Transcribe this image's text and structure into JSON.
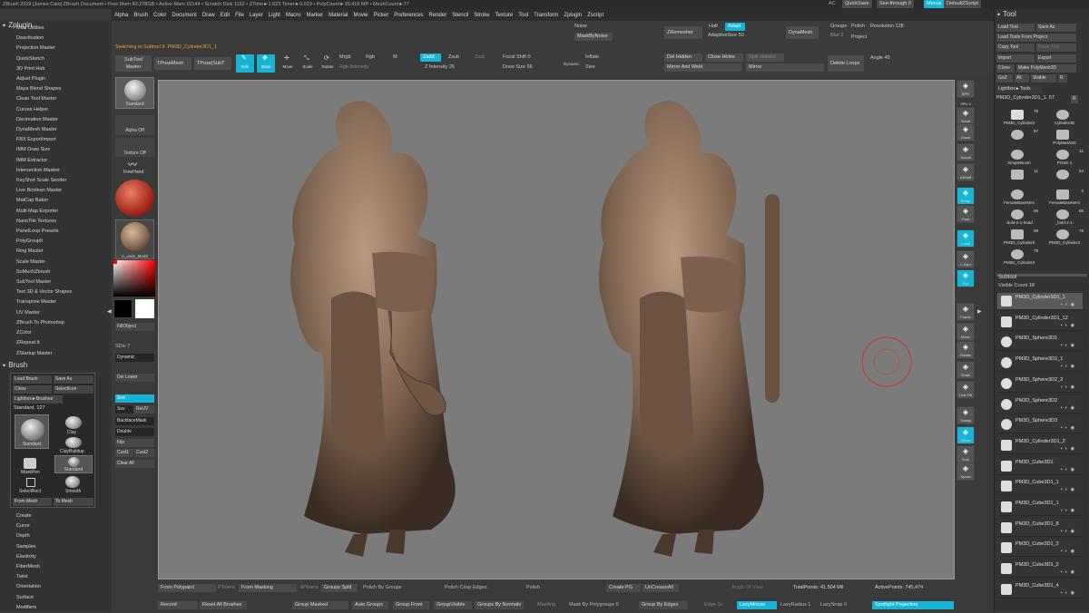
{
  "title": "ZBrush 2019 [James Cain]   ZBrush Document    • Free Mem 42.278GB • Active Mem 15144 • Scratch Disk 1162 • ZTime►1.623 Timer►0.019 • PolyCount►39.415 MP • MeshCount►77",
  "titlebar_right": {
    "ac": "AC",
    "quicksave": "QuickSave",
    "seethrough": "See-through  0",
    "menus": "Menus",
    "script": "DefaultZScript"
  },
  "menu": [
    "Alpha",
    "Brush",
    "Color",
    "Document",
    "Draw",
    "Edit",
    "File",
    "Layer",
    "Light",
    "Macro",
    "Marker",
    "Material",
    "Movie",
    "Picker",
    "Preferences",
    "Render",
    "Stencil",
    "Stroke",
    "Texture",
    "Tool",
    "Transform",
    "Zplugin",
    "Zscript"
  ],
  "left": {
    "zplugin_title": "Zplugin",
    "plugins": [
      "Misc Utilities",
      "Deactivation",
      "Projection Master",
      "QuickSketch",
      "3D Print Hub",
      "Adjust Plugin",
      "Maya Blend Shapes",
      "Clean Tool Master",
      "Curves Helper",
      "Decimation Master",
      "DynaMesh Master",
      "FBX ExportImport",
      "IMM Draw Size",
      "IMM Extractor",
      "Intersection Masker",
      "KeyShot Scale Sender",
      "Live Boolean Master",
      "MatCap Baker",
      "Multi Map Exporter",
      "NanoTile Textures",
      "PanelLoop Presets",
      "PolyGroupIt",
      "Ring Master",
      "Scale Master",
      "SoMuchZbrush",
      "SubTool Master",
      "Text 3D & Vector Shapes",
      "Transpose Master",
      "UV Master",
      "ZBrush To Photoshop",
      "ZColor",
      "ZRepeat It",
      "ZStartup Master"
    ],
    "brush_title": "Brush",
    "brush": {
      "load": "Load Brush",
      "save": "Save As",
      "clone": "Clone",
      "selicon": "SelectIcon",
      "lightbox": "Lightbox►Brushes",
      "standard": "Standard. 127",
      "b_standard": "Standard",
      "clay": "Clay",
      "claybuildup": "ClayBuildup",
      "maskpen": "MaskPen",
      "standard2": "Standard",
      "selectrect": "SelectRect",
      "smooth": "Smooth",
      "frommesh": "From Mesh",
      "tomesh": "To Mesh"
    },
    "curve_items": [
      "Create",
      "Curve",
      "Depth",
      "Samples",
      "Elasticity",
      "FiberMesh",
      "Twist",
      "Orientation",
      "Surface",
      "Modifiers"
    ]
  },
  "shelf": {
    "standard": "Standard",
    "alphaoff": "Alpha Off",
    "textureoff": "Texture Off",
    "freehand": "FreeHand",
    "matname": "o_undo_Mud3",
    "fillobject": "FillObject",
    "sdiv": "SDiv 7",
    "dynamic": "Dynamic",
    "dellower": "Del Lower",
    "smt": "Smt",
    "suv": "Suv",
    "reuv": "ReUV",
    "backfacemask": "BackfaceMask",
    "double": "Double",
    "flip": "Flip",
    "cust1": "Cust1",
    "cust2": "Cust2",
    "clearall": "Clear All"
  },
  "top": {
    "switching": "Switching to Subtool 9:  PM3D_Cylinder3D1_1",
    "subtool_master": "SubTool Master",
    "tposemesh": "TPoseMesh",
    "tposesubt": "TPose|SubT",
    "edit": "Edit",
    "draw": "Draw",
    "move": "Move",
    "scale": "Scale",
    "rotate": "Rotate",
    "mrgb": "Mrgb",
    "rgb": "Rgb",
    "m": "M",
    "rgb_int": "Rgb Intensity",
    "zadd": "Zadd",
    "zsub": "Zsub",
    "zcut": "Zcut",
    "z_int": "Z Intensity 25",
    "focal": "Focal Shift 0",
    "drawsize": "Draw Size 56",
    "dynamic": "Dynamic",
    "noise": "Noise",
    "masknoise": "MaskByNoise",
    "inflate": "Inflate",
    "size": "Size",
    "delhidden": "Del Hidden",
    "closeholes": "Close Holes",
    "splithidden": "Split Hidden",
    "mirrorweld": "Mirror And Weld",
    "mirror": "Mirror",
    "zremesher": "ZRemesher",
    "half": "Half",
    "adapt": "Adapt",
    "adaptsize": "AdaptiveSize 50",
    "dynamesh": "DynaMesh",
    "groups": "Groups",
    "polish": "Polish",
    "blur": "Blur 2",
    "project": "Project",
    "resolution": "Resolution 128",
    "deleteloops": "Delete Loops",
    "angle": "Angle 45"
  },
  "rightshelf": [
    "BPR",
    "SPix 3",
    "Scroll",
    "Zoom",
    "Actual",
    "AAHalf",
    "Persp",
    "Floor",
    "Local",
    "L.Sym",
    "Xyz",
    "Frame",
    "Move",
    "Rotate",
    "Scale",
    "Line Fill PolyF",
    "Transp",
    "Ghost",
    "Solo",
    "Xpose"
  ],
  "tool": {
    "title": "Tool",
    "load": "Load Tool",
    "saveas": "Save As",
    "loadproj": "Load Tools From Project",
    "copy": "Copy Tool",
    "paste": "Paste Tool",
    "import": "Import",
    "export": "Export",
    "clone": "Clone",
    "makepoly": "Make PolyMesh3D",
    "goz": "GoZ",
    "all": "All",
    "visible": "Visible",
    "r": "R",
    "lightbox": "Lightbox►Tools",
    "current": "PM3D_Cylinder3D1_1. 57",
    "r2": "R",
    "thumbs": [
      {
        "name": "PM3D_Cylinder3",
        "num": "78"
      },
      {
        "name": "Cylinder3D",
        "num": ""
      },
      {
        "name": "",
        "num": "57"
      },
      {
        "name": "PolyMesh3D",
        "num": ""
      },
      {
        "name": "SimpleBrush",
        "num": ""
      },
      {
        "name": "POSE-1",
        "num": "11"
      },
      {
        "name": "",
        "num": "11"
      },
      {
        "name": "",
        "num": "54"
      },
      {
        "name": "FemaleBaseMes",
        "num": ""
      },
      {
        "name": "FemaleBaseMes",
        "num": "2"
      },
      {
        "name": "-bold-2-1-head",
        "num": "59"
      },
      {
        "name": "_bold-2-1-",
        "num": "68"
      },
      {
        "name": "PM3D_Cylinder3",
        "num": "69"
      },
      {
        "name": "PM3D_Cylinder3",
        "num": "76"
      },
      {
        "name": "PM3D_Cylinder3",
        "num": "79"
      }
    ],
    "subtool": "Subtool",
    "visiblecount": "Visible Count 18",
    "subtools": [
      "PM3D_Cylinder3D1_1",
      "PM3D_Cylinder3D1_12",
      "PM3D_Sphere3D1",
      "PM3D_Sphere3D2_1",
      "PM3D_Sphere3D2_2",
      "PM3D_Sphere3D2",
      "PM3D_Sphere3D3",
      "PM3D_Cylinder3D1_2",
      "PM3D_Cube3D1",
      "PM3D_Cube3D1_1",
      "PM3D_Cube3D1_1",
      "PM3D_Cube3D1_8",
      "PM3D_Cube3D1_2",
      "PM3D_Cube3D1_2",
      "PM3D_Cube3D1_4"
    ]
  },
  "bottom": {
    "frompolypaint": "From Polypaint",
    "ptolerance": "PTolera",
    "frommasking": "From Masking",
    "mtolerance": "MTolera",
    "groupssplit": "Groups Split",
    "polishgroups": "Polish By Groups",
    "crisp": "Polish Crisp Edges",
    "polish": "Polish",
    "createpg": "Create PG",
    "uncrease": "UnCreaseAll",
    "angle": "Angle Of View",
    "totalpoints": "TotalPoints: 41.504 Mil",
    "activepoints": "ActivePoints: 745,474",
    "record": "Record",
    "resetbrushes": "Reset All Brushes",
    "groupmasked": "Group Masked",
    "autogroups": "Auto Groups",
    "groupfront": "Group Front",
    "groupvisible": "GroupVisible",
    "groupsnormals": "Groups By Normals",
    "maxang": "MaxAng",
    "maskbypg": "Mask By Polygroups 0",
    "groupedges": "Group By Edges",
    "edgesc": "Edge Sc",
    "lazymouse": "LazyMouse",
    "lazyradius": "LazyRadius 1",
    "lazysnap": "LazySnap 0",
    "spotlight": "Spotlight Projection"
  },
  "colors": {
    "accent": "#17b4d6",
    "material": "#8a6a52",
    "orange_text": "#e8a23a"
  }
}
